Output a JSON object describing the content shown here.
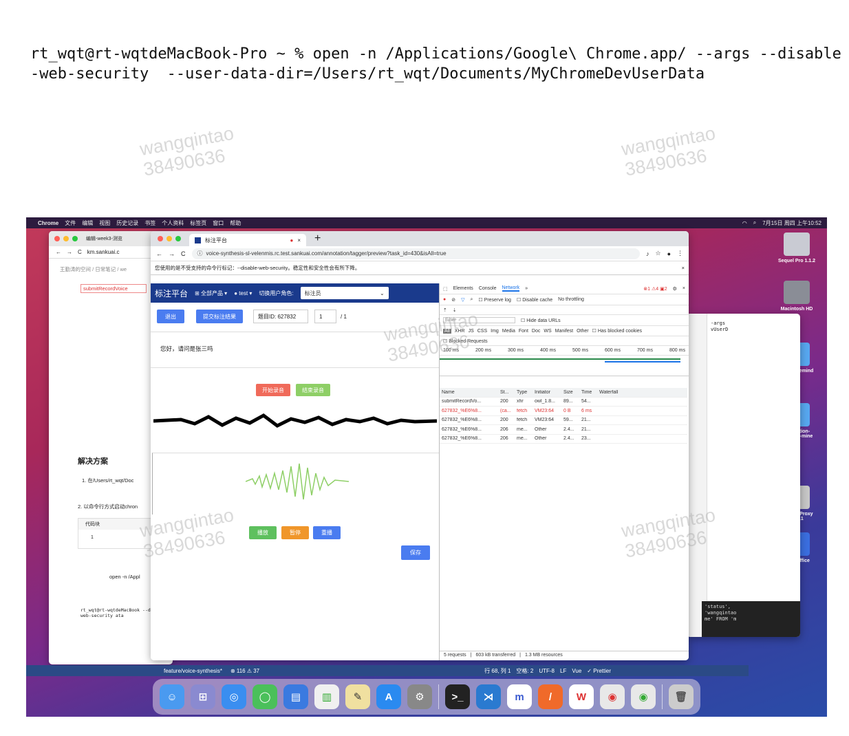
{
  "command": "rt_wqt@rt-wqtdeMacBook-Pro ~ % open -n /Applications/Google\\ Chrome.app/ --args --disable-web-security  --user-data-dir=/Users/rt_wqt/Documents/MyChromeDevUserData",
  "watermarks": [
    {
      "name": "wangqintao",
      "id": "38490636"
    }
  ],
  "menubar": {
    "app": "Chrome",
    "items": [
      "文件",
      "编辑",
      "视图",
      "历史记录",
      "书签",
      "个人资料",
      "标签页",
      "窗口",
      "帮助"
    ],
    "clock": "7月15日 周四 上午10:52"
  },
  "desktop": {
    "icons": [
      "Sequel Pro 1.1.2",
      "Macintosh HD",
      "weekly-remind",
      "annotation-platform-mine",
      "Charles Proxy v4.6.1",
      "WPS Office"
    ]
  },
  "left_window": {
    "tab": "编辑-week3-测览",
    "url": "km.sankuai.c",
    "breadcrumb": "王勤涛的空间 / 日常笔记 / we",
    "record": "submitRecordVoice",
    "heading": "解决方案",
    "step1": "1. 在/Users/rt_wqt/Doc",
    "step2": "2. 以命令行方式启动chron",
    "code_title": "代码块",
    "code_line": "1",
    "open_text": "open -n /Appl",
    "term_text": "rt_wqt@rt-wqtdeMacBook --disable-web-security ata"
  },
  "chrome": {
    "tab_title": "标注平台",
    "url": "voice-synthesis-sl-velenmis.rc.test.sankuai.com/annotation/tagger/preview?task_id=430&isAll=true",
    "infobar": "您使用的是不受支持的命令行标记：--disable-web-security。稳定性和安全性会有所下降。"
  },
  "app": {
    "title": "标注平台",
    "all_products": "全部产品",
    "env": "test",
    "switch_role": "切换用户角色:",
    "role": "标注员",
    "exit": "退出",
    "submit": "提交标注结果",
    "question_id": "题目ID: 627832",
    "page": "1",
    "total": "/ 1",
    "prompt": "您好，请问是张三吗",
    "start_rec": "开始录音",
    "stop_rec": "结束录音",
    "play": "播放",
    "pause": "暂停",
    "replay": "重播",
    "save": "保存"
  },
  "devtools": {
    "tabs": [
      "Elements",
      "Console",
      "Network",
      "»"
    ],
    "errors": "1",
    "warnings": "4",
    "issues": "2",
    "preserve": "Preserve log",
    "disable_cache": "Disable cache",
    "throttle": "No throttling",
    "filter": "Filter",
    "hide_urls": "Hide data URLs",
    "types": [
      "All",
      "XHR",
      "JS",
      "CSS",
      "Img",
      "Media",
      "Font",
      "Doc",
      "WS",
      "Manifest",
      "Other"
    ],
    "blocked_cookies": "Has blocked cookies",
    "blocked": "Blocked Requests",
    "timeline": [
      "100 ms",
      "200 ms",
      "300 ms",
      "400 ms",
      "500 ms",
      "600 ms",
      "700 ms",
      "800 ms"
    ],
    "columns": [
      "Name",
      "St...",
      "Type",
      "Initiator",
      "Size",
      "Time",
      "Waterfall"
    ],
    "rows": [
      {
        "name": "submitRecordVo...",
        "status": "200",
        "type": "xhr",
        "init": "owl_1.8...",
        "size": "89...",
        "time": "54...",
        "err": false
      },
      {
        "name": "627832_%E6%8...",
        "status": "(ca...",
        "type": "fetch",
        "init": "VM23:64",
        "size": "0 B",
        "time": "6 ms",
        "err": true
      },
      {
        "name": "627832_%E6%8...",
        "status": "200",
        "type": "fetch",
        "init": "VM23:64",
        "size": "59...",
        "time": "21...",
        "err": false
      },
      {
        "name": "627832_%E6%8...",
        "status": "206",
        "type": "me...",
        "init": "Other",
        "size": "2.4...",
        "time": "21...",
        "err": false
      },
      {
        "name": "627832_%E6%8...",
        "status": "206",
        "type": "me...",
        "init": "Other",
        "size": "2.4...",
        "time": "23...",
        "err": false
      }
    ],
    "summary": [
      "5 requests",
      "603 kB transferred",
      "1.3 MB resources"
    ]
  },
  "vscode_status": {
    "branch": "feature/voice-synthesis*",
    "problems": "⊗ 116 ⚠ 37",
    "pos": "行 68, 列 1",
    "spaces": "空格: 2",
    "enc": "UTF-8",
    "eol": "LF",
    "lang": "Vue",
    "prettier": "✓ Prettier"
  },
  "right_window": {
    "code1": "-args",
    "code2": "vUserD",
    "code3": "'status',",
    "code4": "'wangqintao",
    "code5": "me' FROM 'm"
  }
}
